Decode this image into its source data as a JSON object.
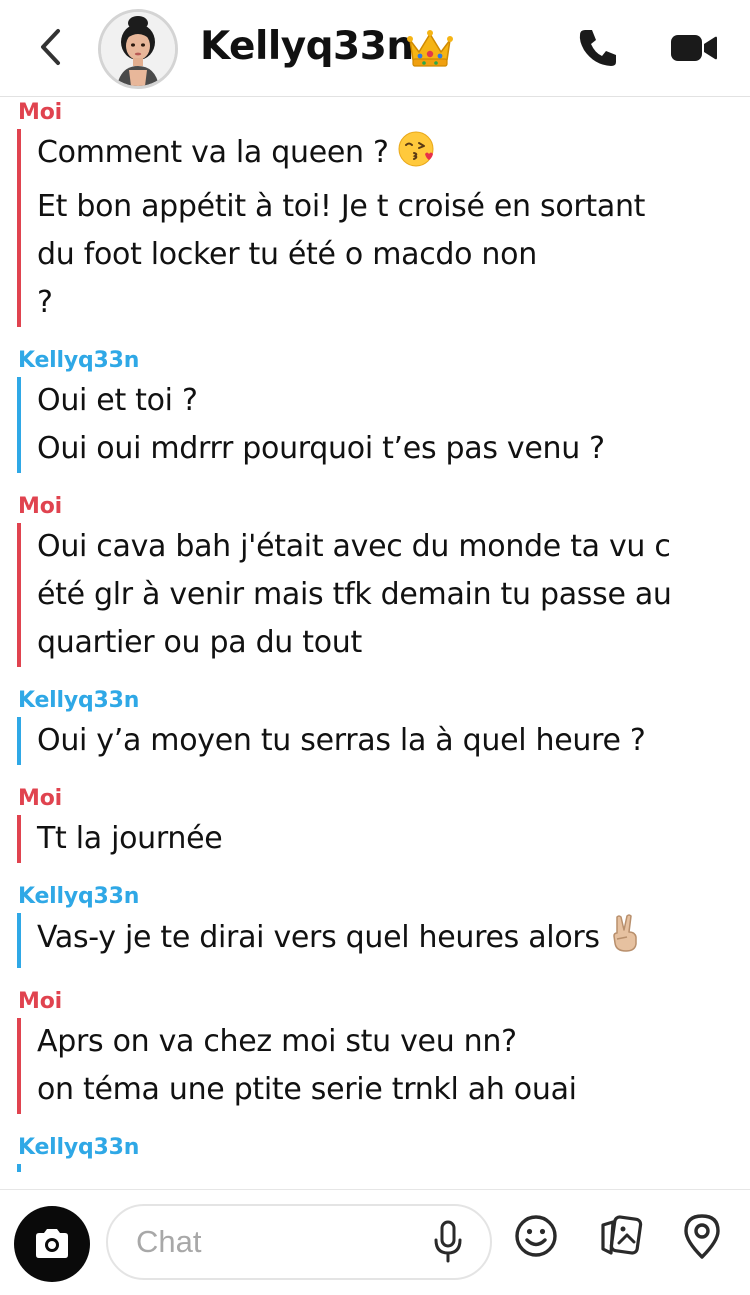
{
  "header": {
    "contact_name": "Kellyq33n",
    "crown_icon": "crown-icon",
    "back_icon": "chevron-left-icon",
    "call_icon": "phone-icon",
    "video_icon": "video-camera-icon"
  },
  "colors": {
    "me": "#e0434f",
    "them": "#2fa8e6"
  },
  "messages": [
    {
      "sender": "Moi",
      "side": "me",
      "lines": [
        "Comment va la queen ?",
        "Et bon appétit à toi! Je t croisé en sortant",
        "du foot locker tu été o macdo non",
        "?"
      ],
      "emoji": {
        "line": 0,
        "icon": "kissing-face-emoji"
      }
    },
    {
      "sender": "Kellyq33n",
      "side": "them",
      "lines": [
        "Oui et toi ?",
        "Oui oui mdrrr pourquoi t’es pas venu ?"
      ]
    },
    {
      "sender": "Moi",
      "side": "me",
      "lines": [
        "Oui cava bah j'était avec du monde ta vu c",
        "été glr à venir mais tfk demain tu passe au",
        "quartier ou pa du tout"
      ]
    },
    {
      "sender": "Kellyq33n",
      "side": "them",
      "lines": [
        "Oui y’a moyen tu serras la à quel heure ?"
      ]
    },
    {
      "sender": "Moi",
      "side": "me",
      "lines": [
        "Tt la journée"
      ]
    },
    {
      "sender": "Kellyq33n",
      "side": "them",
      "lines": [
        "Vas-y je te dirai vers quel heures alors"
      ],
      "emoji": {
        "line": 0,
        "icon": "victory-hand-emoji"
      }
    },
    {
      "sender": "Moi",
      "side": "me",
      "lines": [
        "Aprs on va chez moi stu veu nn?",
        "on téma une ptite serie trnkl ah ouai"
      ]
    },
    {
      "sender": "Kellyq33n",
      "side": "them",
      "lines": []
    }
  ],
  "composer": {
    "placeholder": "Chat",
    "camera_icon": "camera-icon",
    "mic_icon": "microphone-icon",
    "smiley_icon": "smiley-icon",
    "stickers_icon": "memories-cards-icon",
    "location_icon": "location-pin-icon"
  }
}
